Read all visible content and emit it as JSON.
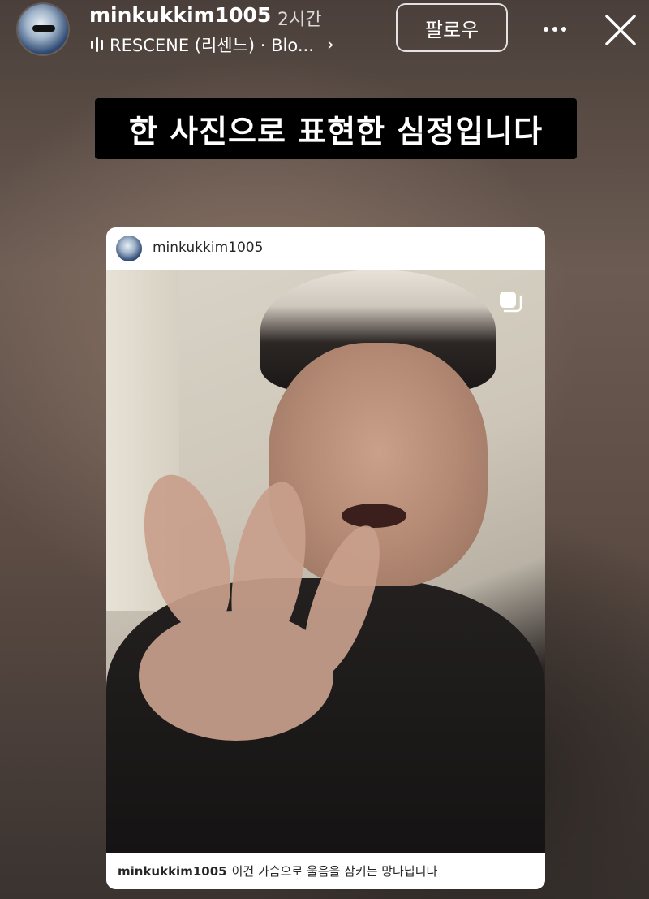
{
  "header": {
    "username": "minkukkim1005",
    "time_ago": "2시간",
    "music_label": "RESCENE (리센느) · Blo...",
    "follow_label": "팔로우"
  },
  "caption": "한 사진으로 표현한 심정입니다",
  "post": {
    "username": "minkukkim1005",
    "caption_user": "minkukkim1005",
    "caption_text": "이건 가슴으로 울음을 삼키는 망나닙니다"
  },
  "icons": {
    "music": "audio-bars-icon",
    "more": "more-dots-icon",
    "close": "close-icon",
    "carousel": "multiple-posts-icon"
  }
}
